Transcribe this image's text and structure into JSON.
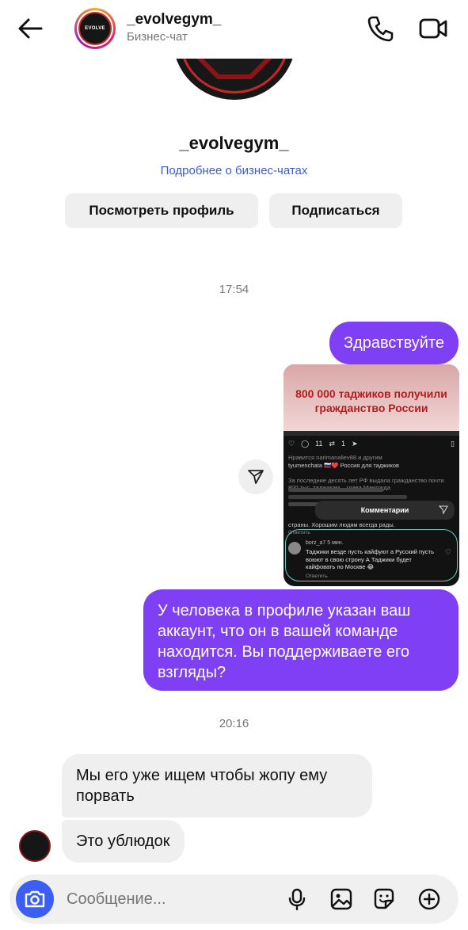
{
  "header": {
    "username": "_evolvegym_",
    "subtitle": "Бизнес-чат",
    "avatar_logo": "EVOLVE"
  },
  "profile": {
    "name": "_evolvegym_",
    "business_link": "Подробнее о бизнес-чатах",
    "view_profile_label": "Посмотреть профиль",
    "follow_label": "Подписаться"
  },
  "timestamps": [
    "17:54",
    "20:16"
  ],
  "messages": {
    "hello": "Здравствуйте",
    "question": "У человека в профиле указан ваш аккаунт, что он в вашей команде находится. Вы поддерживаете его взгляды?",
    "reply1": "Мы его уже ищем чтобы жопу ему порвать",
    "reply2": "Это ублюдок"
  },
  "shared_post": {
    "headline": "800 000 таджиков получили гражданство России",
    "comments_count": "11",
    "reposts_count": "1",
    "liked_by": "Нравится narimanaliev88 и другим",
    "caption": "tyumenchata 🇷🇺❤️ Россия для таджиков",
    "body": "За последние десять лет РФ выдала гражданство почти 800 тыс. таджикам – глава Минтруда",
    "comments_title": "Комментарии",
    "blurred_tail": "страны. Хорошим людям всегда рады.",
    "reply_label": "Ответить",
    "commenter": "borz_a7",
    "comment_time": "5 мин.",
    "comment_text": "Таджики везде пусть кайфуют а Русский пусть воюют в свою строну А Таджики будет кайфовать по Москве 😂",
    "comment_reply": "Ответить"
  },
  "composer": {
    "placeholder": "Сообщение..."
  },
  "icons": {
    "back": "arrow-left-icon",
    "call": "phone-icon",
    "video": "video-camera-icon",
    "share": "send-icon",
    "camera": "camera-icon",
    "mic": "microphone-icon",
    "gallery": "image-icon",
    "sticker": "sticker-icon",
    "more": "plus-circle-icon"
  },
  "colors": {
    "outgoing_bubble": "#7f3ff4",
    "incoming_bubble": "#efefef",
    "link": "#3a5bd9",
    "camera_button": "#3b5ef5"
  }
}
